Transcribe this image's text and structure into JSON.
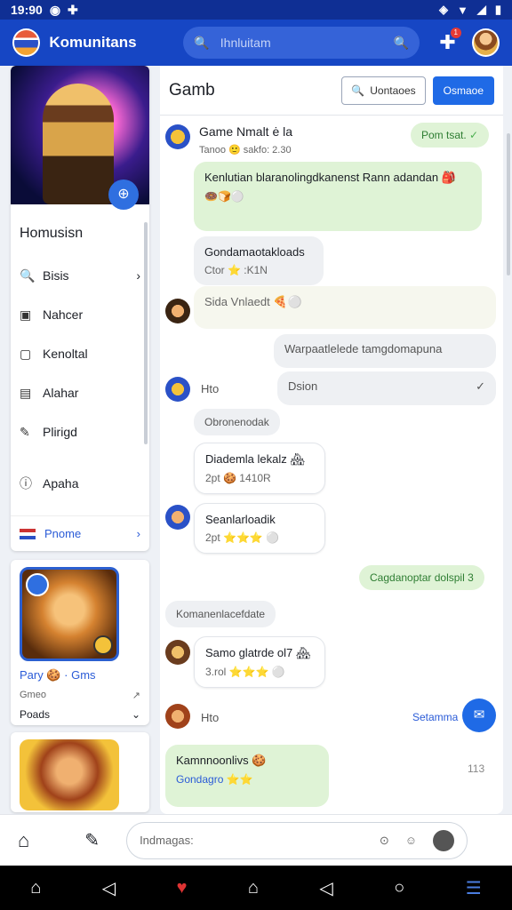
{
  "status": {
    "time": "19:90",
    "icons": [
      "github-icon",
      "puzzle-icon"
    ],
    "right_icons": [
      "nfc-icon",
      "wifi-icon",
      "battery-icon"
    ]
  },
  "appbar": {
    "title": "Komunitans",
    "search_placeholder": "Ihnluitam",
    "badge": "1"
  },
  "sidebar": {
    "menu_title": "Homusisn",
    "items": [
      {
        "label": "Bisis",
        "icon": "search-icon"
      },
      {
        "label": "Nahcer",
        "icon": "shield-icon"
      },
      {
        "label": "Kenoltal",
        "icon": "square-icon"
      },
      {
        "label": "Alahar",
        "icon": "table-icon"
      },
      {
        "label": "Plirigd",
        "icon": "edit-icon"
      },
      {
        "label": "Apaha",
        "icon": "info-icon"
      }
    ],
    "promo_label": "Pnome"
  },
  "game_card": {
    "name": "Pary 🍪 · Gms",
    "sub1": "Gmeo",
    "sub2": "Poads"
  },
  "main": {
    "title": "Gamb",
    "btn_outline": "Uontaoes",
    "btn_primary": "Osmaoe"
  },
  "messages": {
    "m1_title": "Game Nmalt ė la",
    "m1_sub": "Tanoo 🙂 sakfo: 2.30",
    "m1_tag": "Pom tsat.",
    "m2_text": "Kenlutian blaranolingdkanenst Rann adandan 🎒",
    "m2_emojis": "🍩🍞⚪",
    "m3_title": "Gondamaotakloads",
    "m3_sub": "Ctor ⭐ :K1N",
    "m4_text": "Sida Vnlaedt 🍕⚪",
    "m5_text": "Warpaatlelede tamgdomapuna",
    "m6_label": "Hto",
    "m6_text": "Dsion",
    "m7_text": "Obronenodak",
    "m8_title": "Diademla lekalz 🏘",
    "m8_sub": "2pt 🍪 1410R",
    "m9_title": "Seanlarloadik",
    "m9_sub": "2pt ⭐⭐⭐ ⚪",
    "m10_text": "Cagdanoptar dolspil 3",
    "m11_text": "Komanenlacefdate",
    "m12_title": "Samo glatrde ol7 🏘",
    "m12_sub": "3.rol ⭐⭐⭐ ⚪",
    "m13_label": "Hto",
    "m13_link": "Setamma",
    "m14_title": "Kamnnoonlivs 🍪",
    "m14_sub": "Gondagro ⭐⭐",
    "m14_time": "113"
  },
  "compose": {
    "placeholder": "Indmagas:"
  },
  "colors": {
    "accent": "#1646c4",
    "primary_button": "#1f6ae6",
    "green_bubble": "#dff3d6"
  }
}
